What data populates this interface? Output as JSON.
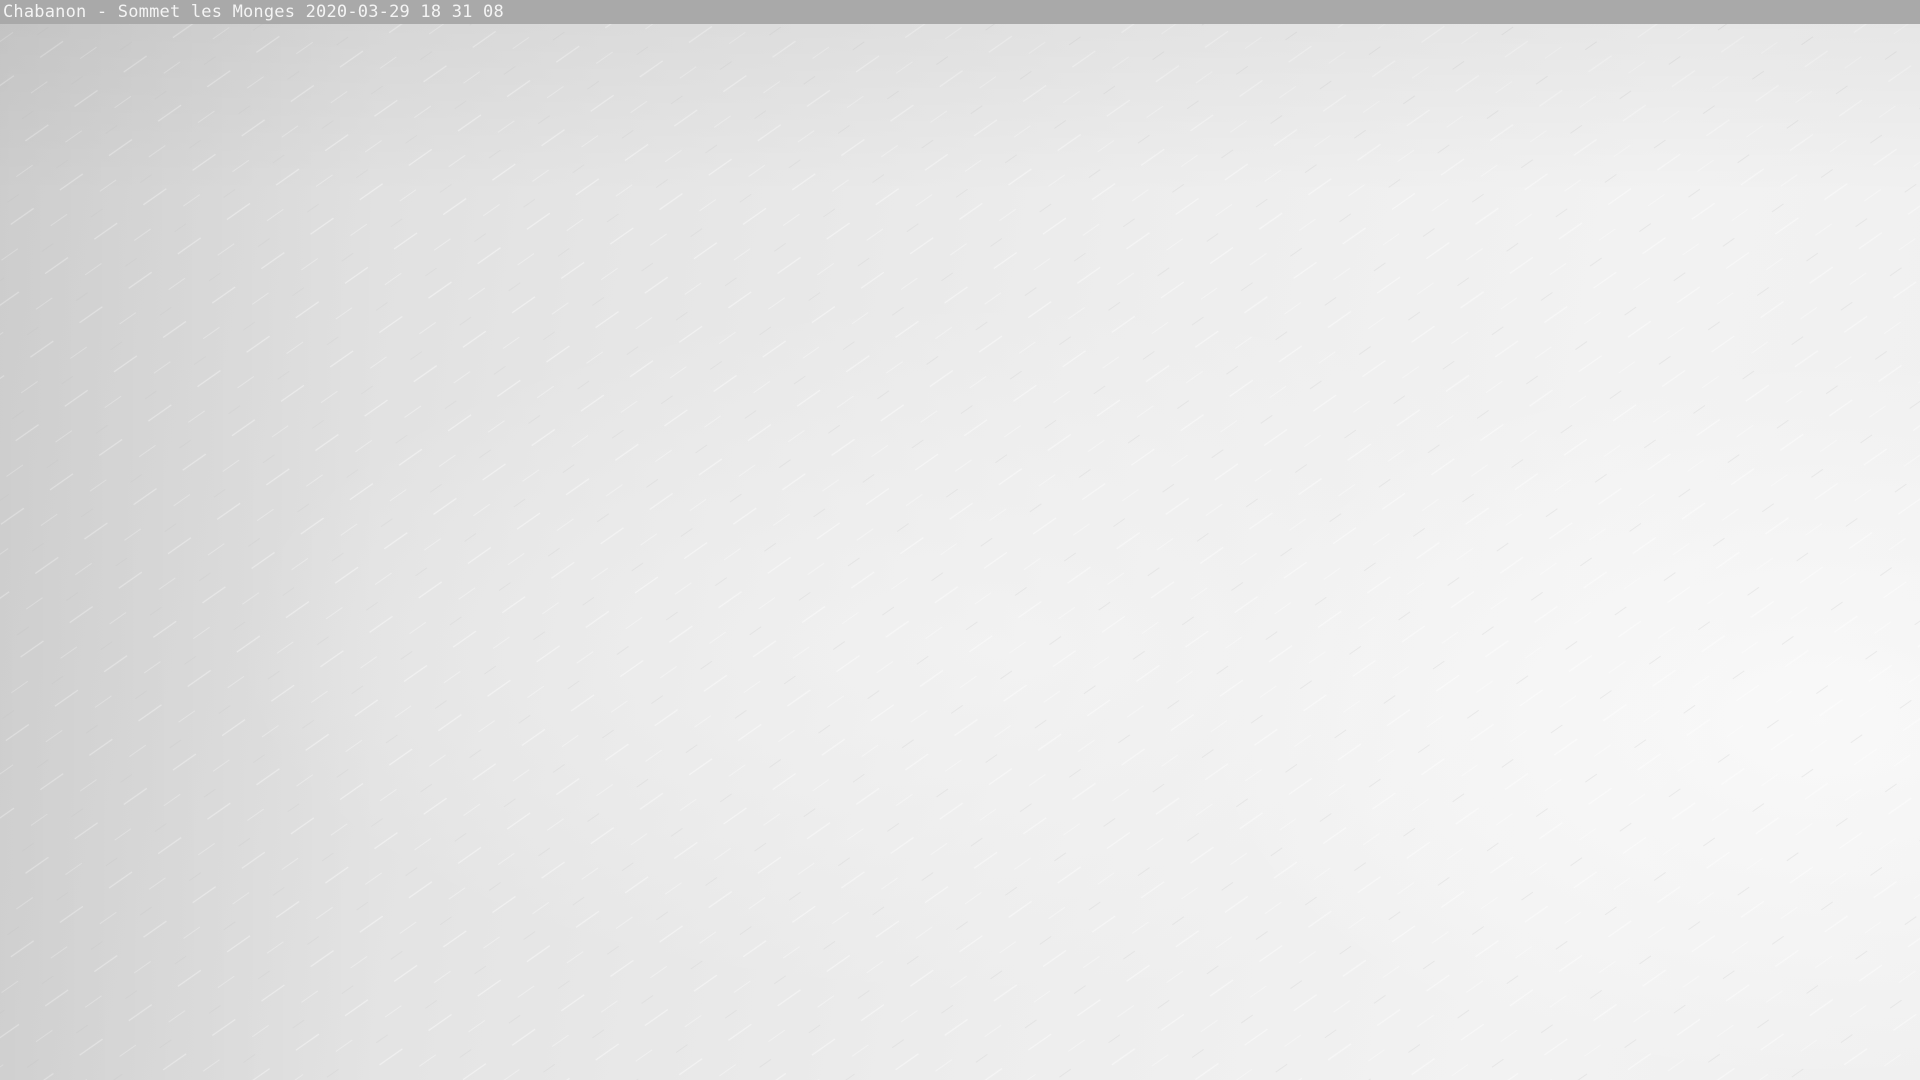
{
  "webcam": {
    "caption": "Chabanon - Sommet les Monges 2020-03-29 18 31 08"
  },
  "colors": {
    "caption_bar": "#a9a9a9",
    "caption_text": "#f4f4f4",
    "snow": "#ececec"
  }
}
